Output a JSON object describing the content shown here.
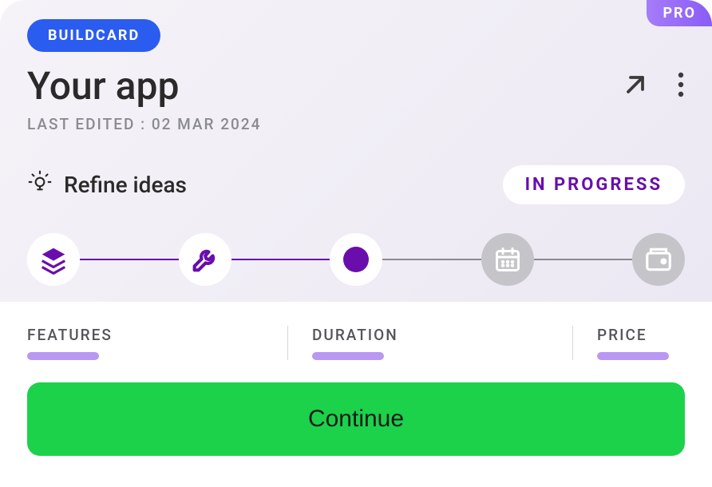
{
  "badges": {
    "pro": "PRO",
    "buildcard": "BUILDCARD"
  },
  "title": "Your app",
  "last_edited_label": "LAST EDITED : 02 MAR 2024",
  "refine": {
    "label": "Refine ideas",
    "status": "IN PROGRESS"
  },
  "metrics": {
    "features": "FEATURES",
    "duration": "DURATION",
    "price": "PRICE"
  },
  "cta": "Continue"
}
